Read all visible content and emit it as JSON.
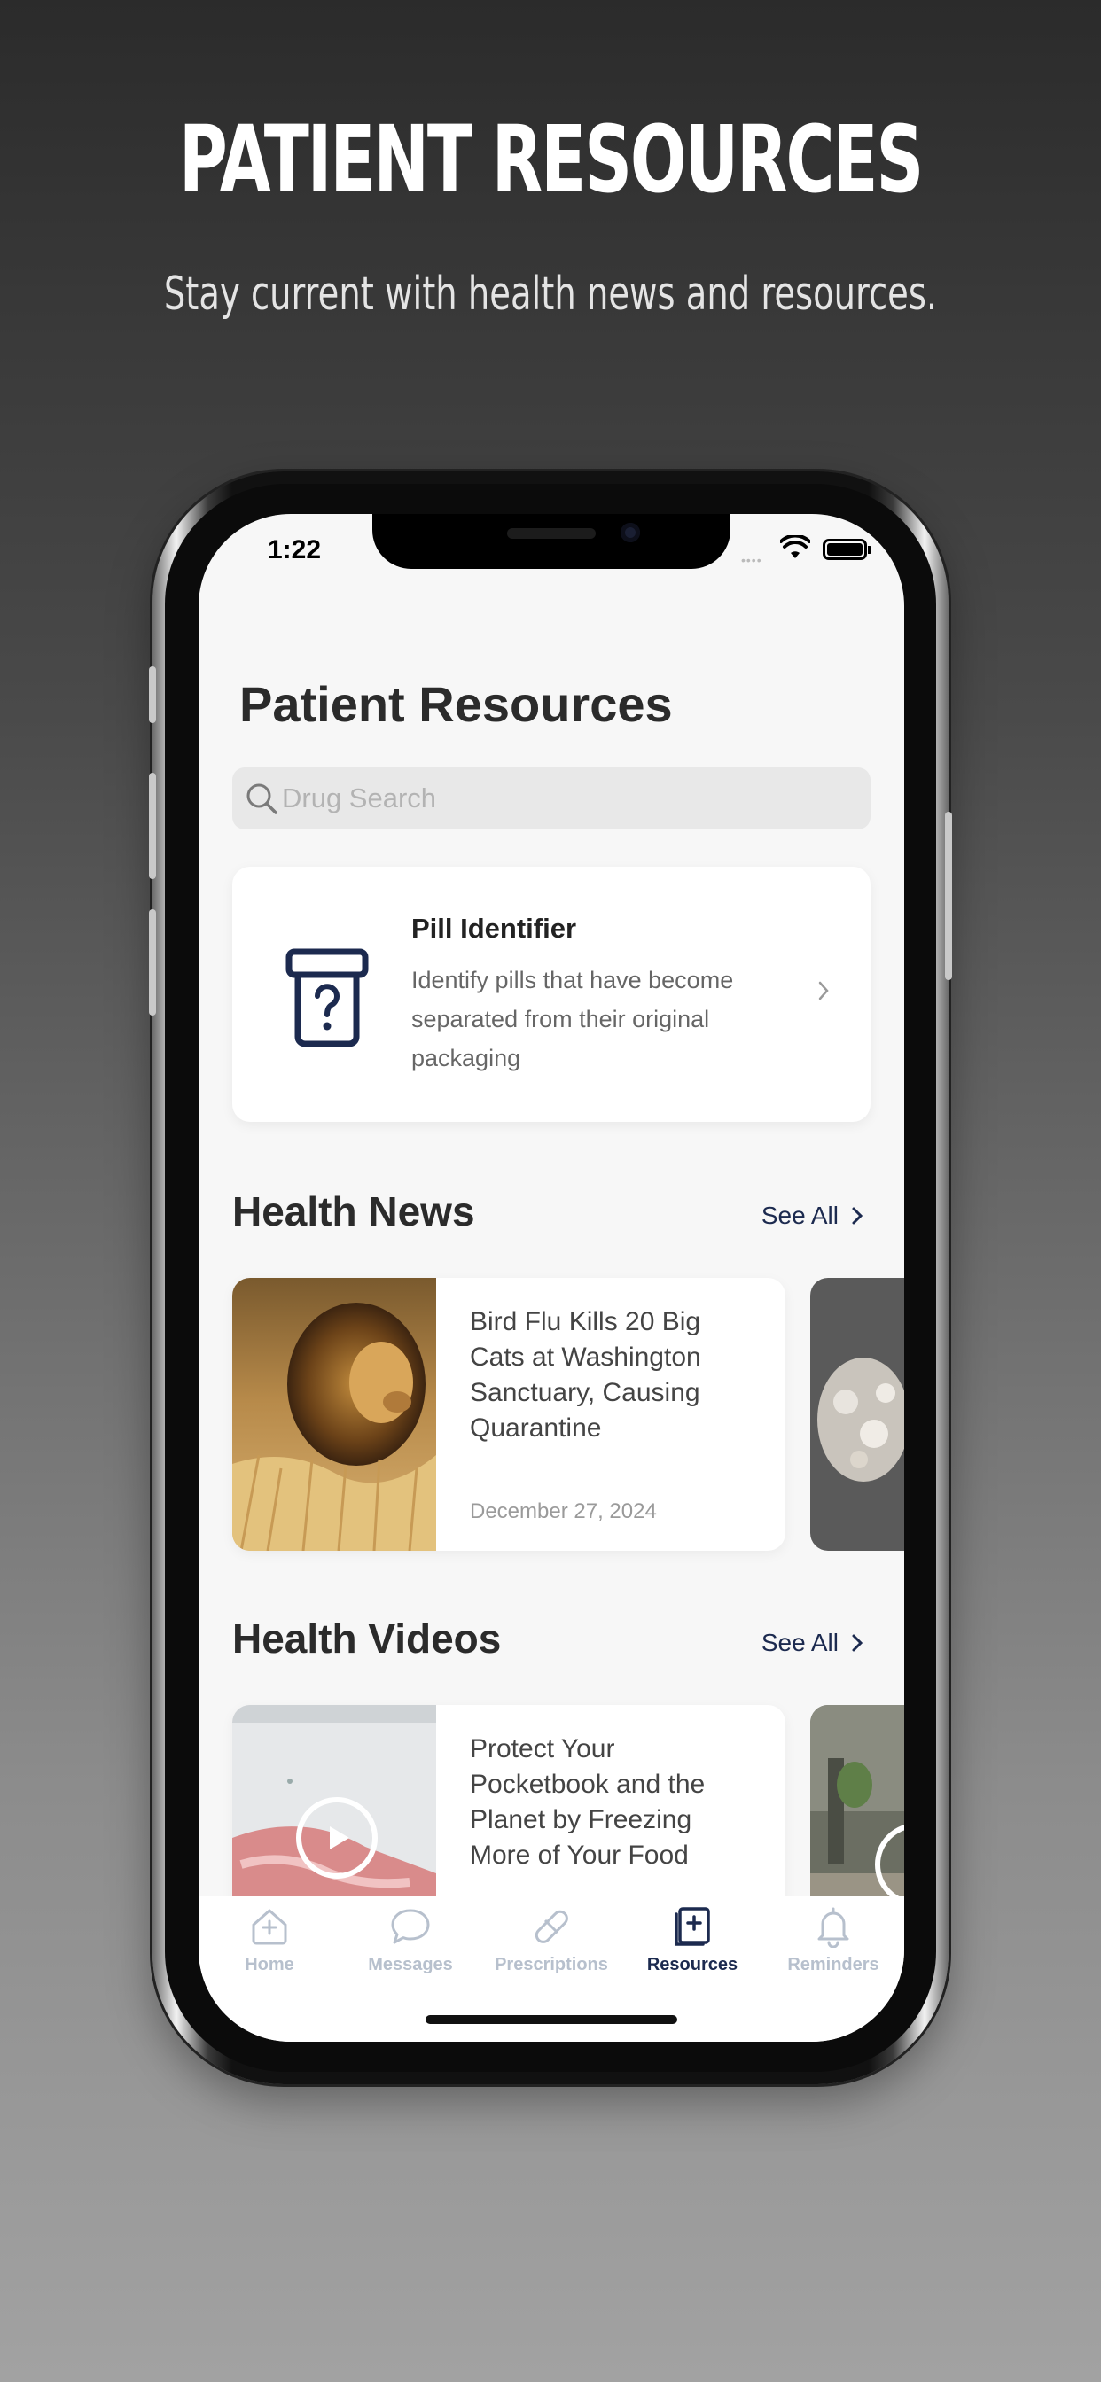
{
  "promo": {
    "title": "PATIENT RESOURCES",
    "subtitle": "Stay current with health news and resources."
  },
  "status_bar": {
    "time": "1:22",
    "dots": "••••"
  },
  "page": {
    "title": "Patient Resources"
  },
  "search": {
    "placeholder": "Drug Search",
    "value": "",
    "icon": "search-icon"
  },
  "pill_identifier": {
    "title": "Pill Identifier",
    "description": "Identify pills that have become separated from their original packaging",
    "icon": "pill-bottle-question-icon"
  },
  "health_news": {
    "title": "Health News",
    "see_all": "See All",
    "articles": [
      {
        "title": "Bird Flu Kills 20 Big Cats at Washington Sanctuary, Causing Quarantine",
        "date": "December 27, 2024"
      }
    ]
  },
  "health_videos": {
    "title": "Health Videos",
    "see_all": "See All",
    "videos": [
      {
        "title": "Protect Your Pocketbook and the Planet by Freezing More of Your Food"
      }
    ]
  },
  "tab_bar": {
    "items": [
      {
        "label": "Home",
        "icon": "home-plus-icon"
      },
      {
        "label": "Messages",
        "icon": "chat-bubble-icon"
      },
      {
        "label": "Prescriptions",
        "icon": "pill-capsule-icon"
      },
      {
        "label": "Resources",
        "icon": "book-plus-icon"
      },
      {
        "label": "Reminders",
        "icon": "bell-icon"
      }
    ],
    "active": "Resources"
  },
  "colors": {
    "accent": "#1c2a4f",
    "tab_inactive": "#b7c0cd",
    "screen_bg": "#f7f7f7"
  }
}
